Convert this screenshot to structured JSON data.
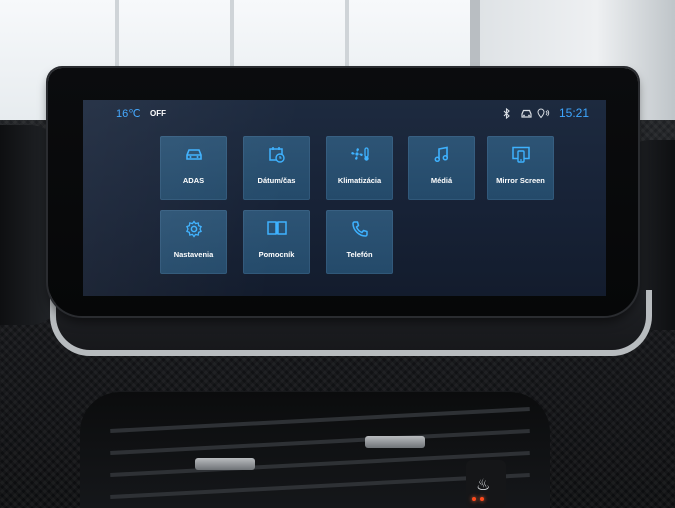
{
  "status_bar": {
    "temperature": "16℃",
    "climate_state": "OFF",
    "clock": "15:21",
    "icons": [
      "bluetooth-icon",
      "connected-car-icon",
      "gps-signal-icon"
    ]
  },
  "apps": [
    {
      "label": "ADAS",
      "icon": "car-icon"
    },
    {
      "label": "Dátum/čas",
      "icon": "calendar-clock-icon"
    },
    {
      "label": "Klimatizácia",
      "icon": "fan-thermometer-icon"
    },
    {
      "label": "Médiá",
      "icon": "music-note-icon"
    },
    {
      "label": "Mirror Screen",
      "icon": "mirror-screen-icon"
    },
    {
      "label": "Nastavenia",
      "icon": "gear-icon"
    },
    {
      "label": "Pomocník",
      "icon": "book-icon"
    },
    {
      "label": "Telefón",
      "icon": "phone-icon"
    }
  ],
  "colors": {
    "accent": "#3ea6ff",
    "tile": "#2b5273",
    "screen_bg": "#1a263a"
  }
}
